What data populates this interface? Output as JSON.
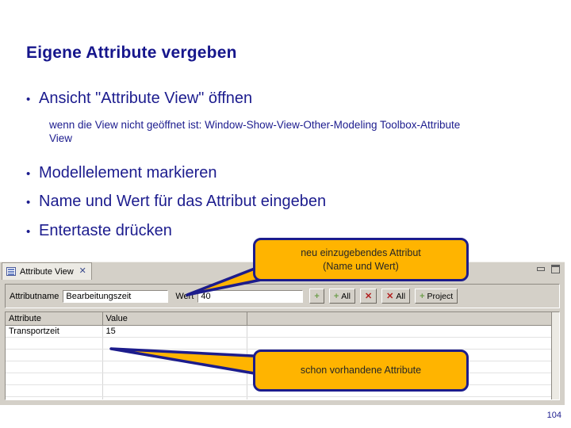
{
  "slide": {
    "title": "Eigene Attribute vergeben",
    "page_number": "104",
    "bullets": [
      "Ansicht \"Attribute View\" öffnen",
      "Modellelement markieren",
      "Name und Wert für das Attribut eingeben",
      "Entertaste drücken"
    ],
    "subtext": "wenn die View nicht geöffnet ist: Window-Show-View-Other-Modeling Toolbox-Attribute View",
    "bullet_marker": "•",
    "title_color": "#16168c",
    "text_color": "#1c1c8e"
  },
  "view": {
    "tab": {
      "label": "Attribute View",
      "close_glyph": "✕",
      "icon": "table-list-icon"
    },
    "controls": {
      "minimize": "minimize-icon",
      "maximize": "maximize-icon"
    },
    "form": {
      "name_label": "Attributname",
      "name_value": "Bearbeitungszeit",
      "name_placeholder": "Attributname",
      "value_label": "Wert",
      "value_value": "40",
      "value_placeholder": "Wert",
      "buttons": [
        {
          "id": "add",
          "icon": "plus-icon",
          "icon_glyph": "+",
          "label": ""
        },
        {
          "id": "add-all",
          "icon": "plus-icon",
          "icon_glyph": "+",
          "label": "All"
        },
        {
          "id": "remove",
          "icon": "cross-icon",
          "icon_glyph": "✕",
          "label": ""
        },
        {
          "id": "remove-all",
          "icon": "cross-icon",
          "icon_glyph": "✕",
          "label": "All"
        },
        {
          "id": "add-project",
          "icon": "plus-icon",
          "icon_glyph": "+",
          "label": "Project"
        }
      ],
      "plus_color": "#6f9e4e",
      "cross_color": "#b21f1f"
    },
    "table": {
      "columns": [
        "Attribute",
        "Value",
        ""
      ],
      "rows": [
        [
          "Transportzeit",
          "15",
          ""
        ],
        [
          "",
          "",
          ""
        ],
        [
          "",
          "",
          ""
        ],
        [
          "",
          "",
          ""
        ],
        [
          "",
          "",
          ""
        ],
        [
          "",
          "",
          ""
        ],
        [
          "",
          "",
          ""
        ]
      ]
    }
  },
  "callouts": {
    "new_attribute": {
      "line1": "neu einzugebendes Attribut",
      "line2": "(Name und Wert)"
    },
    "existing_attributes": {
      "line1": "schon vorhandene Attribute"
    },
    "fill_color": "#ffb400",
    "border_color": "#1c1c8c"
  }
}
